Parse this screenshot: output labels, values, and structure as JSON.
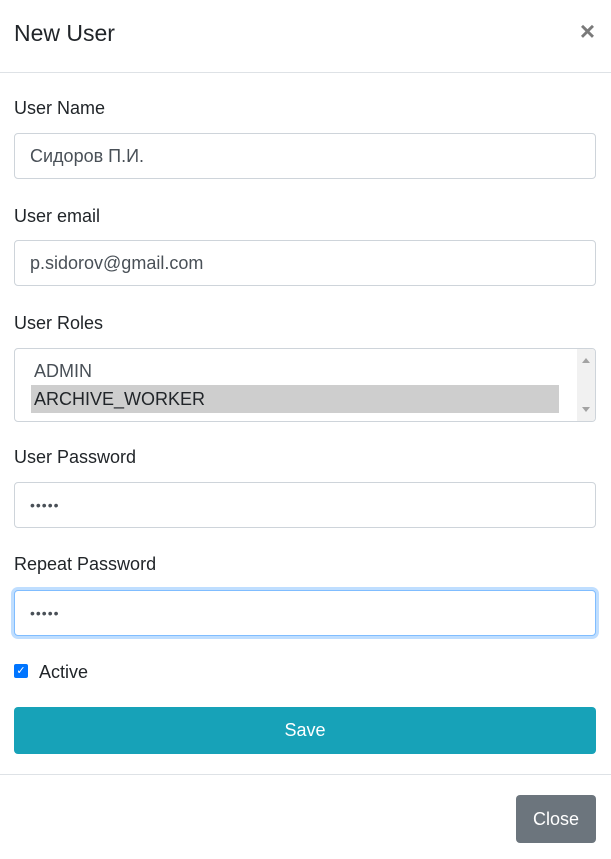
{
  "modal": {
    "title": "New User",
    "close_icon": "×"
  },
  "form": {
    "user_name": {
      "label": "User Name",
      "value": "Сидоров П.И."
    },
    "user_email": {
      "label": "User email",
      "value": "p.sidorov@gmail.com"
    },
    "user_roles": {
      "label": "User Roles",
      "options": [
        {
          "label": "ADMIN",
          "selected": false
        },
        {
          "label": "ARCHIVE_WORKER",
          "selected": true
        }
      ]
    },
    "password": {
      "label": "User Password",
      "value": "•••••"
    },
    "repeat_password": {
      "label": "Repeat Password",
      "value": "•••••"
    },
    "active": {
      "label": "Active",
      "checked": true,
      "check_glyph": "✓"
    },
    "save_label": "Save"
  },
  "footer": {
    "close_label": "Close"
  },
  "colors": {
    "save": "#17a2b8",
    "close": "#6c757d",
    "checkbox": "#0075ff",
    "focus": "#80bdff"
  }
}
